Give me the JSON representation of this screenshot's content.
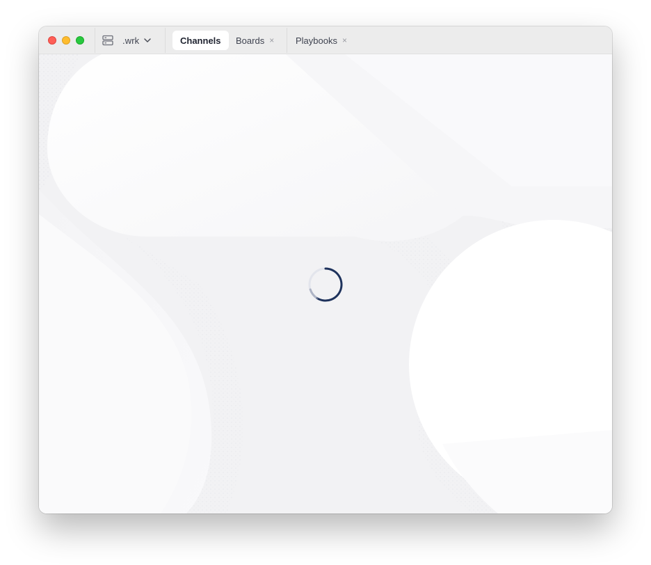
{
  "window": {
    "traffic_lights": {
      "close": "#fe5f57",
      "minimize": "#febc2e",
      "maximize": "#28c840"
    }
  },
  "server": {
    "icon": "server-icon",
    "name": ".wrk",
    "dropdown_icon": "chevron-down-icon"
  },
  "tabs": [
    {
      "label": "Channels",
      "active": true,
      "closable": false
    },
    {
      "label": "Boards",
      "active": false,
      "closable": true,
      "close_glyph": "×"
    },
    {
      "label": "Playbooks",
      "active": false,
      "closable": true,
      "close_glyph": "×"
    }
  ],
  "content": {
    "state": "loading",
    "spinner_icon": "loading-spinner-icon",
    "spinner_color": "#1e325c"
  }
}
